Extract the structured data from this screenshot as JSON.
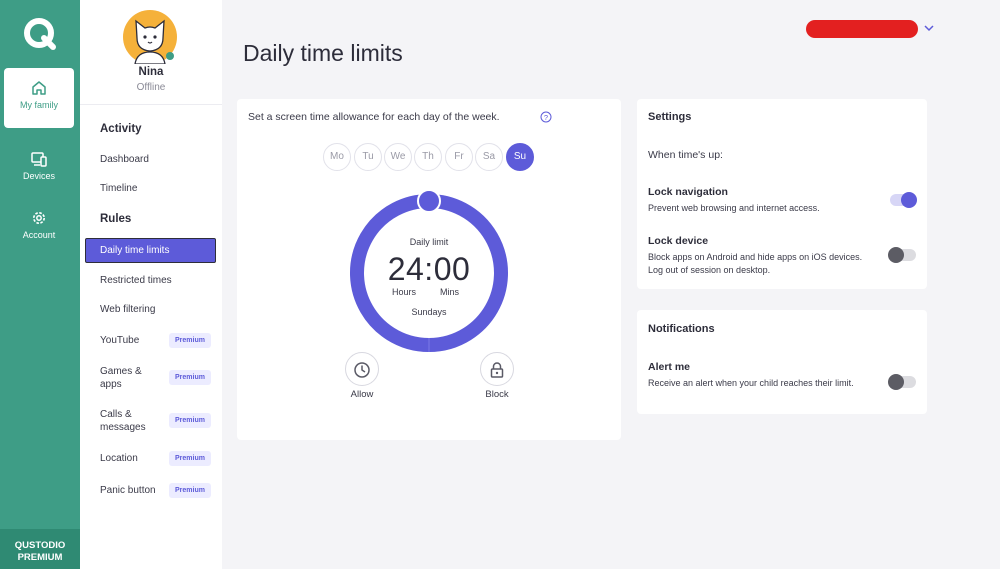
{
  "rail": {
    "items": [
      {
        "label": "My family",
        "icon": "home-icon",
        "active": true
      },
      {
        "label": "Devices",
        "icon": "devices-icon",
        "active": false
      },
      {
        "label": "Account",
        "icon": "gear-icon",
        "active": false
      }
    ],
    "premium_line1": "QUSTODIO",
    "premium_line2": "PREMIUM"
  },
  "child": {
    "name": "Nina",
    "status": "Offline"
  },
  "sidebar": {
    "activity_heading": "Activity",
    "activity_links": [
      "Dashboard",
      "Timeline"
    ],
    "rules_heading": "Rules",
    "rules_links": [
      {
        "label": "Daily time limits",
        "active": true,
        "premium": false
      },
      {
        "label": "Restricted times",
        "premium": false
      },
      {
        "label": "Web filtering",
        "premium": false
      },
      {
        "label": "YouTube",
        "premium": true
      },
      {
        "label": "Games & apps",
        "line1": "Games &",
        "line2": "apps",
        "premium": true
      },
      {
        "label": "Calls & messages",
        "line1": "Calls &",
        "line2": "messages",
        "premium": true
      },
      {
        "label": "Location",
        "premium": true
      },
      {
        "label": "Panic button",
        "premium": true
      }
    ],
    "premium_badge": "Premium"
  },
  "page": {
    "title": "Daily time limits"
  },
  "limits": {
    "intro": "Set a screen time allowance for each day of the week.",
    "days": [
      "Mo",
      "Tu",
      "We",
      "Th",
      "Fr",
      "Sa",
      "Su"
    ],
    "selected_day": "Su",
    "dial_label": "Daily limit",
    "time": "24:00",
    "hours_label": "Hours",
    "mins_label": "Mins",
    "day_name": "Sundays",
    "allow_label": "Allow",
    "block_label": "Block",
    "limit_fraction": 1.0
  },
  "settings": {
    "title": "Settings",
    "subtitle": "When time's up:",
    "lock_navigation": {
      "title": "Lock navigation",
      "desc": "Prevent web browsing and internet access.",
      "on": true
    },
    "lock_device": {
      "title": "Lock device",
      "desc": "Block apps on Android and hide apps on iOS devices. Log out of session on desktop.",
      "on": false
    }
  },
  "notifications": {
    "title": "Notifications",
    "alert_me": {
      "title": "Alert me",
      "desc": "Receive an alert when your child reaches their limit.",
      "on": false
    }
  },
  "colors": {
    "brand_green": "#3e9d86",
    "accent_purple": "#5d5bd9",
    "redaction": "#e32020"
  }
}
